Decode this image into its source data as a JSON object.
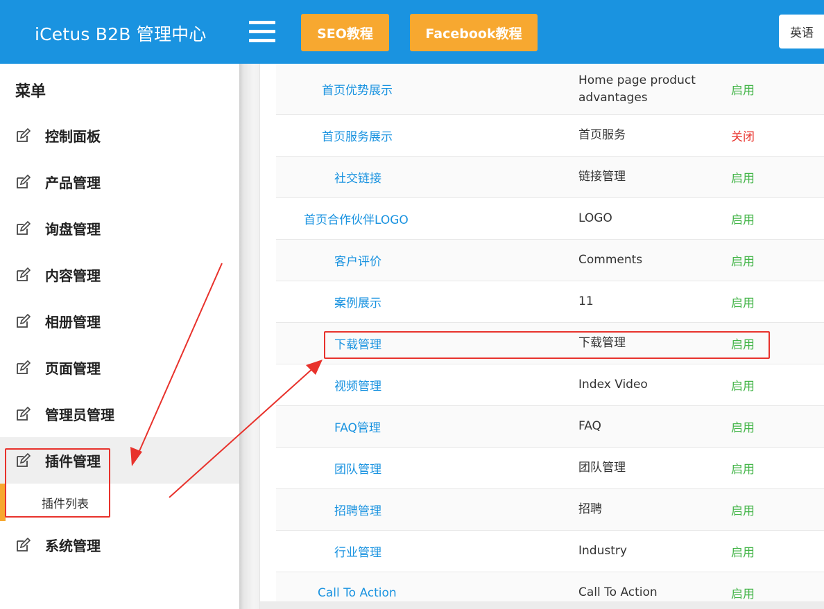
{
  "header": {
    "brand": "iCetus B2B 管理中心",
    "buttons": {
      "seo": "SEO教程",
      "facebook": "Facebook教程"
    },
    "language": "英语",
    "colors": {
      "bar": "#1a93e0",
      "button": "#f7a830"
    }
  },
  "sidebar": {
    "title": "菜单",
    "items": [
      {
        "label": "控制面板",
        "icon": "edit-icon"
      },
      {
        "label": "产品管理",
        "icon": "edit-icon"
      },
      {
        "label": "询盘管理",
        "icon": "edit-icon"
      },
      {
        "label": "内容管理",
        "icon": "edit-icon"
      },
      {
        "label": "相册管理",
        "icon": "edit-icon"
      },
      {
        "label": "页面管理",
        "icon": "edit-icon"
      },
      {
        "label": "管理员管理",
        "icon": "edit-icon"
      },
      {
        "label": "插件管理",
        "icon": "edit-icon",
        "active": true
      },
      {
        "label": "系统管理",
        "icon": "edit-icon"
      }
    ],
    "sub_item": {
      "label": "插件列表"
    }
  },
  "plugins": {
    "rows": [
      {
        "name": "首页优势展示",
        "desc": "Home page product advantages",
        "status": "启用"
      },
      {
        "name": "首页服务展示",
        "desc": "首页服务",
        "status": "关闭"
      },
      {
        "name": "社交链接",
        "desc": "链接管理",
        "status": "启用"
      },
      {
        "name": "首页合作伙伴LOGO",
        "desc": "LOGO",
        "status": "启用"
      },
      {
        "name": "客户评价",
        "desc": "Comments",
        "status": "启用"
      },
      {
        "name": "案例展示",
        "desc": "11",
        "status": "启用"
      },
      {
        "name": "下载管理",
        "desc": "下载管理",
        "status": "启用"
      },
      {
        "name": "视频管理",
        "desc": "Index Video",
        "status": "启用"
      },
      {
        "name": "FAQ管理",
        "desc": "FAQ",
        "status": "启用"
      },
      {
        "name": "团队管理",
        "desc": "团队管理",
        "status": "启用"
      },
      {
        "name": "招聘管理",
        "desc": "招聘",
        "status": "启用"
      },
      {
        "name": "行业管理",
        "desc": "Industry",
        "status": "启用"
      },
      {
        "name": "Call To Action",
        "desc": "Call To Action",
        "status": "启用"
      }
    ],
    "status_colors": {
      "on": "#44b549",
      "off": "#e8322c"
    }
  },
  "annotation": {
    "color": "#e8322c"
  }
}
